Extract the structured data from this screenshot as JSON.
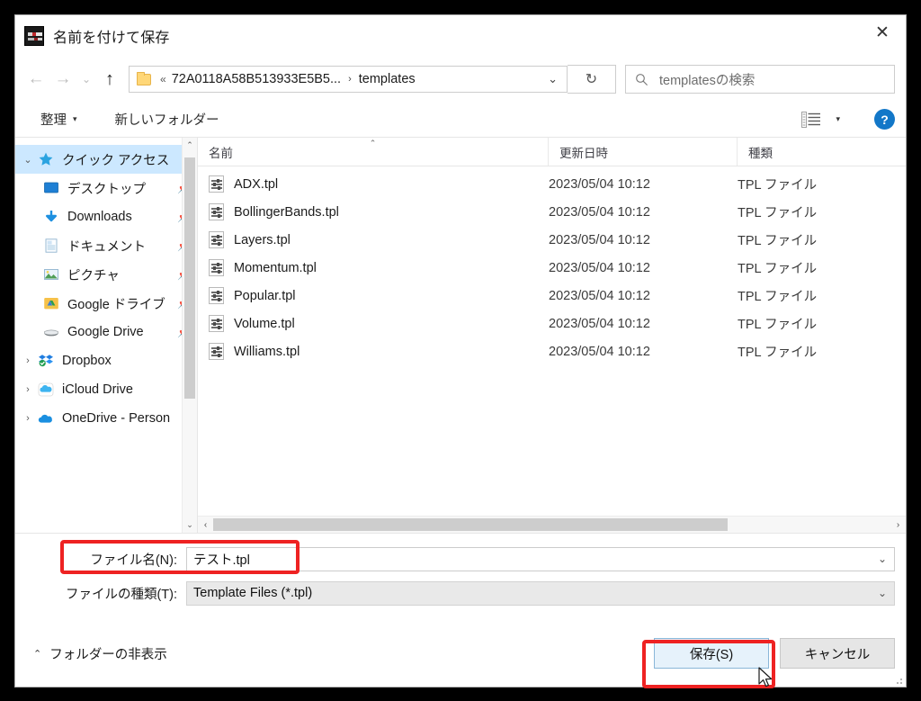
{
  "window": {
    "title": "名前を付けて保存",
    "app_icon": "metatrader-icon",
    "close_label": "✕"
  },
  "navbar": {
    "back_label": "←",
    "forward_label": "→",
    "recent_label": "⌄",
    "up_label": "↑",
    "refresh_label": "↻",
    "breadcrumb": {
      "overflow": "«",
      "segments": [
        "72A0118A58B513933E5B5...",
        "templates"
      ],
      "separator": "›",
      "dropdown": "⌄"
    },
    "search": {
      "placeholder": "templatesの検索",
      "icon": "search-icon"
    }
  },
  "toolbar": {
    "organize_label": "整理",
    "organize_caret": "▾",
    "new_folder_label": "新しいフォルダー",
    "view_caret": "▾",
    "help_label": "?"
  },
  "sidebar": {
    "items": [
      {
        "label": "クイック アクセス",
        "icon": "star-icon",
        "expander": "⌄",
        "selected": true,
        "child": false,
        "pinned": false
      },
      {
        "label": "デスクトップ",
        "icon": "desktop-icon",
        "expander": "",
        "selected": false,
        "child": true,
        "pinned": true
      },
      {
        "label": "Downloads",
        "icon": "download-icon",
        "expander": "",
        "selected": false,
        "child": true,
        "pinned": true
      },
      {
        "label": "ドキュメント",
        "icon": "documents-icon",
        "expander": "",
        "selected": false,
        "child": true,
        "pinned": true
      },
      {
        "label": "ピクチャ",
        "icon": "pictures-icon",
        "expander": "",
        "selected": false,
        "child": true,
        "pinned": true
      },
      {
        "label": "Google ドライブ",
        "icon": "google-drive-icon",
        "expander": "",
        "selected": false,
        "child": true,
        "pinned": true
      },
      {
        "label": "Google Drive",
        "icon": "drive-disk-icon",
        "expander": "",
        "selected": false,
        "child": true,
        "pinned": true
      },
      {
        "label": "Dropbox",
        "icon": "dropbox-icon",
        "expander": "›",
        "selected": false,
        "child": false,
        "pinned": false
      },
      {
        "label": "iCloud Drive",
        "icon": "icloud-icon",
        "expander": "›",
        "selected": false,
        "child": false,
        "pinned": false
      },
      {
        "label": "OneDrive - Person",
        "icon": "onedrive-icon",
        "expander": "›",
        "selected": false,
        "child": false,
        "pinned": false,
        "trailing_caret": "⌄"
      }
    ],
    "scroll_up": "⌃",
    "scroll_down": "⌄"
  },
  "filelist": {
    "columns": {
      "name": "名前",
      "date_modified": "更新日時",
      "type": "種類",
      "sort_caret": "⌃"
    },
    "rows": [
      {
        "name": "ADX.tpl",
        "date": "2023/05/04 10:12",
        "type": "TPL ファイル"
      },
      {
        "name": "BollingerBands.tpl",
        "date": "2023/05/04 10:12",
        "type": "TPL ファイル"
      },
      {
        "name": "Layers.tpl",
        "date": "2023/05/04 10:12",
        "type": "TPL ファイル"
      },
      {
        "name": "Momentum.tpl",
        "date": "2023/05/04 10:12",
        "type": "TPL ファイル"
      },
      {
        "name": "Popular.tpl",
        "date": "2023/05/04 10:12",
        "type": "TPL ファイル"
      },
      {
        "name": "Volume.tpl",
        "date": "2023/05/04 10:12",
        "type": "TPL ファイル"
      },
      {
        "name": "Williams.tpl",
        "date": "2023/05/04 10:12",
        "type": "TPL ファイル"
      }
    ],
    "hscroll_left": "‹",
    "hscroll_right": "›"
  },
  "form": {
    "filename_label": "ファイル名(N):",
    "filename_value": "テスト.tpl",
    "filetype_label": "ファイルの種類(T):",
    "filetype_value": "Template Files (*.tpl)",
    "chevron": "⌄"
  },
  "footer": {
    "hide_folders_caret": "⌃",
    "hide_folders_label": "フォルダーの非表示",
    "save_label": "保存(S)",
    "cancel_label": "キャンセル"
  },
  "annotations": {
    "accent_color": "#ee2222",
    "highlighted": [
      "filename-field",
      "save-button"
    ]
  }
}
